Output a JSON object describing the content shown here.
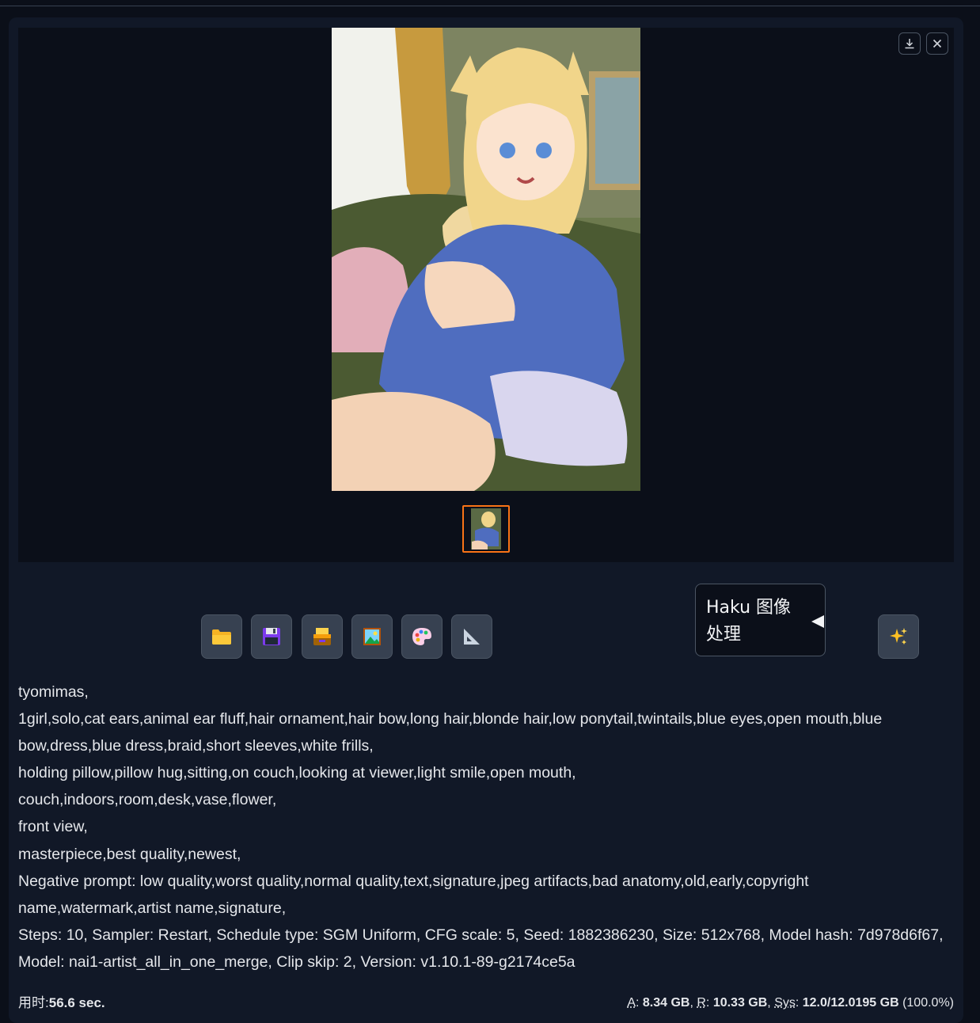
{
  "toolbar_icons": [
    "folder-icon",
    "floppy-disk-icon",
    "card-file-box-icon",
    "framed-picture-icon",
    "artist-palette-icon",
    "triangular-ruler-icon",
    "sparkles-icon"
  ],
  "haku": {
    "label": "Haku 图像处理"
  },
  "generation_info": {
    "lines": [
      "tyomimas,",
      "1girl,solo,cat ears,animal ear fluff,hair ornament,hair bow,long hair,blonde hair,low ponytail,twintails,blue eyes,open mouth,blue bow,dress,blue dress,braid,short sleeves,white frills,",
      "holding pillow,pillow hug,sitting,on couch,looking at viewer,light smile,open mouth,",
      "couch,indoors,room,desk,vase,flower,",
      "front view,",
      "masterpiece,best quality,newest,",
      "Negative prompt: low quality,worst quality,normal quality,text,signature,jpeg artifacts,bad anatomy,old,early,copyright name,watermark,artist name,signature,",
      "Steps: 10, Sampler: Restart, Schedule type: SGM Uniform, CFG scale: 5, Seed: 1882386230, Size: 512x768, Model hash: 7d978d6f67, Model: nai1-artist_all_in_one_merge, Clip skip: 2, Version: v1.10.1-89-g2174ce5a"
    ]
  },
  "footer": {
    "time_label": "用时:",
    "time_value": "56.6 sec.",
    "a_label": "A",
    "a_value": "8.34 GB",
    "r_label": "R",
    "r_value": "10.33 GB",
    "sys_label": "Sys",
    "sys_value": "12.0/12.0195 GB",
    "sys_percent": "(100.0%)"
  },
  "colors": {
    "thumbnail_selected_border": "#f97316",
    "button_bg": "#374151",
    "panel_bg": "#111827",
    "page_bg": "#0b0f19"
  }
}
